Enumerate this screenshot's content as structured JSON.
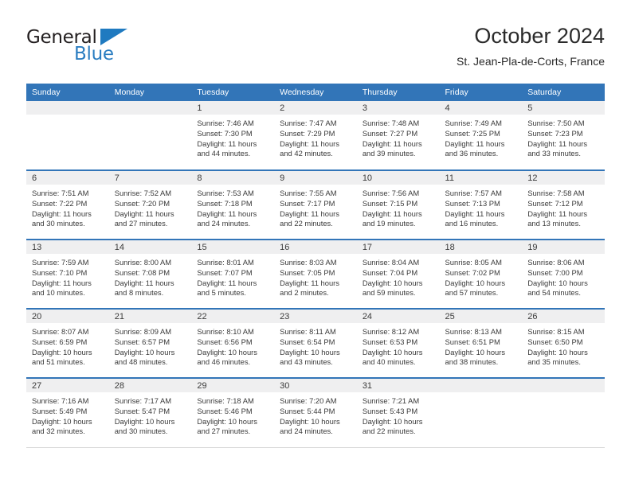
{
  "brand": {
    "name_part1": "General",
    "name_part2": "Blue",
    "triangle_icon": "triangle-icon",
    "color_dark": "#231f20",
    "color_blue": "#2a7dc1"
  },
  "header": {
    "title": "October 2024",
    "subtitle": "St. Jean-Pla-de-Corts, France"
  },
  "theme": {
    "header_blue": "#3275b8",
    "daynum_band": "#efeff0",
    "text": "#3a3a3a"
  },
  "calendar": {
    "weekday_headers": [
      "Sunday",
      "Monday",
      "Tuesday",
      "Wednesday",
      "Thursday",
      "Friday",
      "Saturday"
    ],
    "weeks": [
      [
        {
          "day": "",
          "sunrise": "",
          "sunset": "",
          "daylight_line1": "",
          "daylight_line2": ""
        },
        {
          "day": "",
          "sunrise": "",
          "sunset": "",
          "daylight_line1": "",
          "daylight_line2": ""
        },
        {
          "day": "1",
          "sunrise": "Sunrise: 7:46 AM",
          "sunset": "Sunset: 7:30 PM",
          "daylight_line1": "Daylight: 11 hours",
          "daylight_line2": "and 44 minutes."
        },
        {
          "day": "2",
          "sunrise": "Sunrise: 7:47 AM",
          "sunset": "Sunset: 7:29 PM",
          "daylight_line1": "Daylight: 11 hours",
          "daylight_line2": "and 42 minutes."
        },
        {
          "day": "3",
          "sunrise": "Sunrise: 7:48 AM",
          "sunset": "Sunset: 7:27 PM",
          "daylight_line1": "Daylight: 11 hours",
          "daylight_line2": "and 39 minutes."
        },
        {
          "day": "4",
          "sunrise": "Sunrise: 7:49 AM",
          "sunset": "Sunset: 7:25 PM",
          "daylight_line1": "Daylight: 11 hours",
          "daylight_line2": "and 36 minutes."
        },
        {
          "day": "5",
          "sunrise": "Sunrise: 7:50 AM",
          "sunset": "Sunset: 7:23 PM",
          "daylight_line1": "Daylight: 11 hours",
          "daylight_line2": "and 33 minutes."
        }
      ],
      [
        {
          "day": "6",
          "sunrise": "Sunrise: 7:51 AM",
          "sunset": "Sunset: 7:22 PM",
          "daylight_line1": "Daylight: 11 hours",
          "daylight_line2": "and 30 minutes."
        },
        {
          "day": "7",
          "sunrise": "Sunrise: 7:52 AM",
          "sunset": "Sunset: 7:20 PM",
          "daylight_line1": "Daylight: 11 hours",
          "daylight_line2": "and 27 minutes."
        },
        {
          "day": "8",
          "sunrise": "Sunrise: 7:53 AM",
          "sunset": "Sunset: 7:18 PM",
          "daylight_line1": "Daylight: 11 hours",
          "daylight_line2": "and 24 minutes."
        },
        {
          "day": "9",
          "sunrise": "Sunrise: 7:55 AM",
          "sunset": "Sunset: 7:17 PM",
          "daylight_line1": "Daylight: 11 hours",
          "daylight_line2": "and 22 minutes."
        },
        {
          "day": "10",
          "sunrise": "Sunrise: 7:56 AM",
          "sunset": "Sunset: 7:15 PM",
          "daylight_line1": "Daylight: 11 hours",
          "daylight_line2": "and 19 minutes."
        },
        {
          "day": "11",
          "sunrise": "Sunrise: 7:57 AM",
          "sunset": "Sunset: 7:13 PM",
          "daylight_line1": "Daylight: 11 hours",
          "daylight_line2": "and 16 minutes."
        },
        {
          "day": "12",
          "sunrise": "Sunrise: 7:58 AM",
          "sunset": "Sunset: 7:12 PM",
          "daylight_line1": "Daylight: 11 hours",
          "daylight_line2": "and 13 minutes."
        }
      ],
      [
        {
          "day": "13",
          "sunrise": "Sunrise: 7:59 AM",
          "sunset": "Sunset: 7:10 PM",
          "daylight_line1": "Daylight: 11 hours",
          "daylight_line2": "and 10 minutes."
        },
        {
          "day": "14",
          "sunrise": "Sunrise: 8:00 AM",
          "sunset": "Sunset: 7:08 PM",
          "daylight_line1": "Daylight: 11 hours",
          "daylight_line2": "and 8 minutes."
        },
        {
          "day": "15",
          "sunrise": "Sunrise: 8:01 AM",
          "sunset": "Sunset: 7:07 PM",
          "daylight_line1": "Daylight: 11 hours",
          "daylight_line2": "and 5 minutes."
        },
        {
          "day": "16",
          "sunrise": "Sunrise: 8:03 AM",
          "sunset": "Sunset: 7:05 PM",
          "daylight_line1": "Daylight: 11 hours",
          "daylight_line2": "and 2 minutes."
        },
        {
          "day": "17",
          "sunrise": "Sunrise: 8:04 AM",
          "sunset": "Sunset: 7:04 PM",
          "daylight_line1": "Daylight: 10 hours",
          "daylight_line2": "and 59 minutes."
        },
        {
          "day": "18",
          "sunrise": "Sunrise: 8:05 AM",
          "sunset": "Sunset: 7:02 PM",
          "daylight_line1": "Daylight: 10 hours",
          "daylight_line2": "and 57 minutes."
        },
        {
          "day": "19",
          "sunrise": "Sunrise: 8:06 AM",
          "sunset": "Sunset: 7:00 PM",
          "daylight_line1": "Daylight: 10 hours",
          "daylight_line2": "and 54 minutes."
        }
      ],
      [
        {
          "day": "20",
          "sunrise": "Sunrise: 8:07 AM",
          "sunset": "Sunset: 6:59 PM",
          "daylight_line1": "Daylight: 10 hours",
          "daylight_line2": "and 51 minutes."
        },
        {
          "day": "21",
          "sunrise": "Sunrise: 8:09 AM",
          "sunset": "Sunset: 6:57 PM",
          "daylight_line1": "Daylight: 10 hours",
          "daylight_line2": "and 48 minutes."
        },
        {
          "day": "22",
          "sunrise": "Sunrise: 8:10 AM",
          "sunset": "Sunset: 6:56 PM",
          "daylight_line1": "Daylight: 10 hours",
          "daylight_line2": "and 46 minutes."
        },
        {
          "day": "23",
          "sunrise": "Sunrise: 8:11 AM",
          "sunset": "Sunset: 6:54 PM",
          "daylight_line1": "Daylight: 10 hours",
          "daylight_line2": "and 43 minutes."
        },
        {
          "day": "24",
          "sunrise": "Sunrise: 8:12 AM",
          "sunset": "Sunset: 6:53 PM",
          "daylight_line1": "Daylight: 10 hours",
          "daylight_line2": "and 40 minutes."
        },
        {
          "day": "25",
          "sunrise": "Sunrise: 8:13 AM",
          "sunset": "Sunset: 6:51 PM",
          "daylight_line1": "Daylight: 10 hours",
          "daylight_line2": "and 38 minutes."
        },
        {
          "day": "26",
          "sunrise": "Sunrise: 8:15 AM",
          "sunset": "Sunset: 6:50 PM",
          "daylight_line1": "Daylight: 10 hours",
          "daylight_line2": "and 35 minutes."
        }
      ],
      [
        {
          "day": "27",
          "sunrise": "Sunrise: 7:16 AM",
          "sunset": "Sunset: 5:49 PM",
          "daylight_line1": "Daylight: 10 hours",
          "daylight_line2": "and 32 minutes."
        },
        {
          "day": "28",
          "sunrise": "Sunrise: 7:17 AM",
          "sunset": "Sunset: 5:47 PM",
          "daylight_line1": "Daylight: 10 hours",
          "daylight_line2": "and 30 minutes."
        },
        {
          "day": "29",
          "sunrise": "Sunrise: 7:18 AM",
          "sunset": "Sunset: 5:46 PM",
          "daylight_line1": "Daylight: 10 hours",
          "daylight_line2": "and 27 minutes."
        },
        {
          "day": "30",
          "sunrise": "Sunrise: 7:20 AM",
          "sunset": "Sunset: 5:44 PM",
          "daylight_line1": "Daylight: 10 hours",
          "daylight_line2": "and 24 minutes."
        },
        {
          "day": "31",
          "sunrise": "Sunrise: 7:21 AM",
          "sunset": "Sunset: 5:43 PM",
          "daylight_line1": "Daylight: 10 hours",
          "daylight_line2": "and 22 minutes."
        },
        {
          "day": "",
          "sunrise": "",
          "sunset": "",
          "daylight_line1": "",
          "daylight_line2": ""
        },
        {
          "day": "",
          "sunrise": "",
          "sunset": "",
          "daylight_line1": "",
          "daylight_line2": ""
        }
      ]
    ]
  }
}
